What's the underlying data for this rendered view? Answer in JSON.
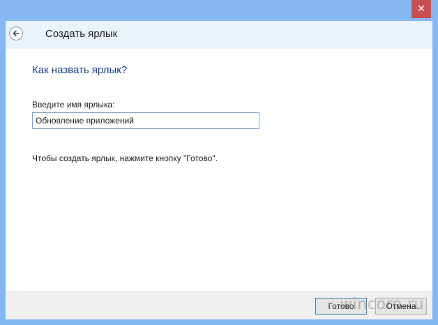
{
  "header": {
    "title": "Создать ярлык"
  },
  "main": {
    "heading": "Как назвать ярлык?",
    "name_label": "Введите имя ярлыка:",
    "name_value": "Обновление приложений",
    "hint": "Чтобы создать ярлык, нажмите кнопку \"Готово\"."
  },
  "footer": {
    "finish_label": "Готово",
    "cancel_label": "Отмена"
  },
  "watermark": "wincore.ru",
  "icons": {
    "close": "close-icon",
    "back": "back-arrow-icon"
  },
  "colors": {
    "frame": "#86b9f2",
    "close_button": "#c75050",
    "heading_text": "#1a3e8c"
  }
}
